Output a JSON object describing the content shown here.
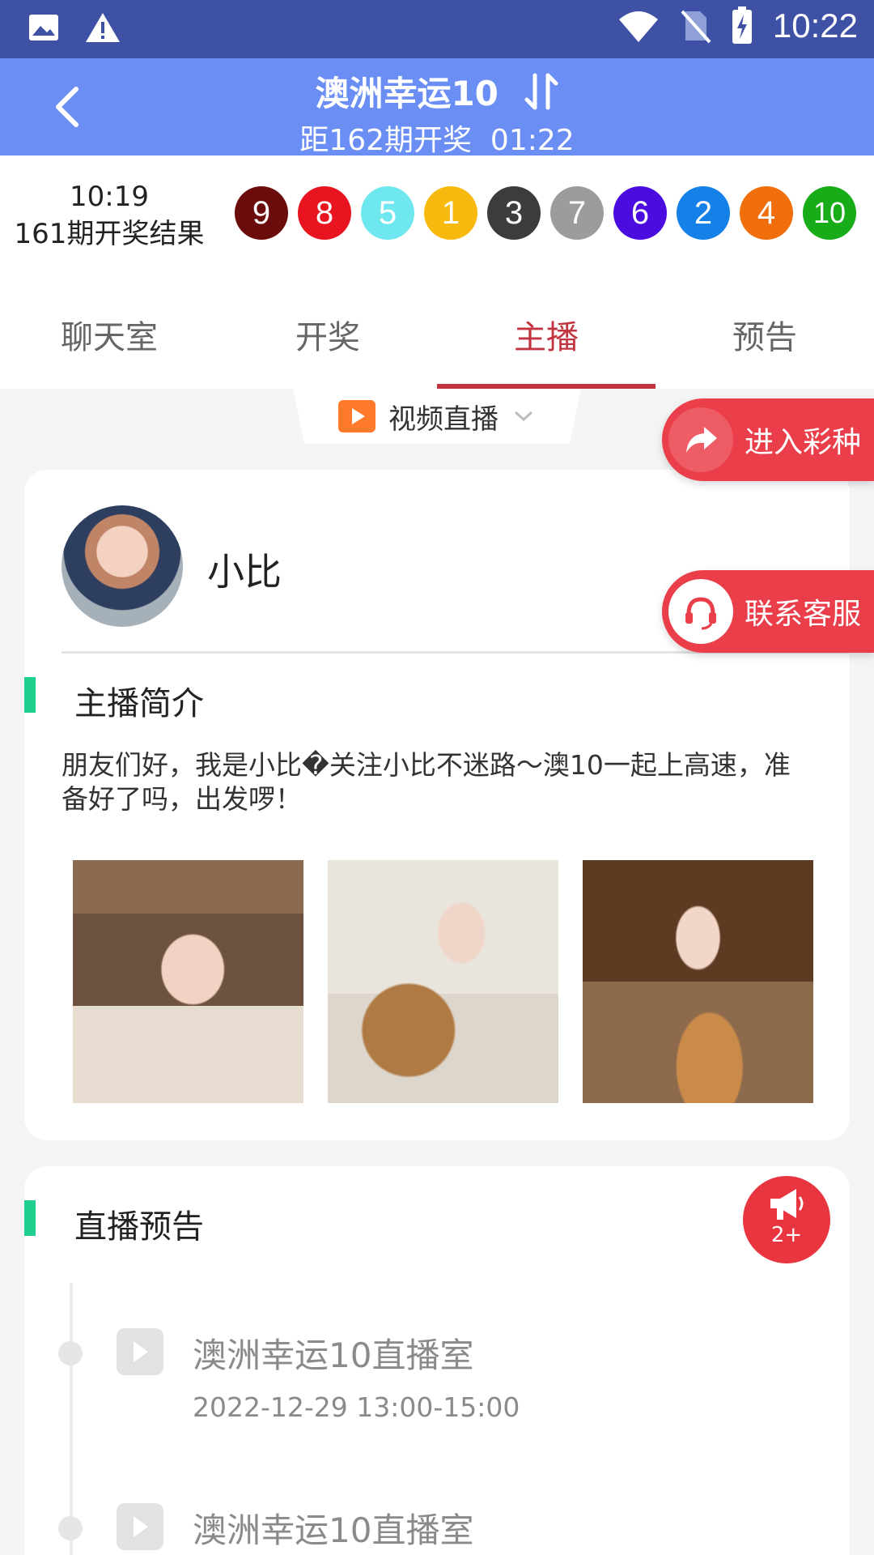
{
  "status_bar": {
    "time": "10:22",
    "icons": [
      "image-icon",
      "warning-icon",
      "wifi-icon",
      "no-sim-icon",
      "battery-charging-icon"
    ]
  },
  "header": {
    "title": "澳洲幸运10",
    "countdown_label": "距162期开奖",
    "countdown": "01:22"
  },
  "last_result": {
    "time": "10:19",
    "label": "161期开奖结果",
    "balls": [
      {
        "n": "9",
        "color": "#6b0c0c"
      },
      {
        "n": "8",
        "color": "#e8141f"
      },
      {
        "n": "5",
        "color": "#6ee8ee"
      },
      {
        "n": "1",
        "color": "#f7b90d"
      },
      {
        "n": "3",
        "color": "#3c3c3c"
      },
      {
        "n": "7",
        "color": "#9c9c9c"
      },
      {
        "n": "6",
        "color": "#4b0ce0"
      },
      {
        "n": "2",
        "color": "#1580e8"
      },
      {
        "n": "4",
        "color": "#f06f0c"
      },
      {
        "n": "10",
        "color": "#18ad18"
      }
    ]
  },
  "tabs": [
    "聊天室",
    "开奖",
    "主播",
    "预告"
  ],
  "active_tab": 2,
  "live_selector": {
    "label": "视频直播"
  },
  "float_buttons": {
    "enter": "进入彩种",
    "service": "联系客服"
  },
  "anchor": {
    "name": "小比",
    "intro_title": "主播简介",
    "intro": "朋友们好，我是小比�关注小比不迷路～澳10一起上高速，准备好了吗，出发啰！"
  },
  "schedule": {
    "title": "直播预告",
    "badge_count": "2+",
    "items": [
      {
        "name": "澳洲幸运10直播室",
        "time": "2022-12-29  13:00-15:00"
      },
      {
        "name": "澳洲幸运10直播室",
        "time": ""
      }
    ]
  },
  "colors": {
    "status_bar": "#3f51a5",
    "header": "#6b8ef5",
    "accent": "#c2343f",
    "float_button": "#ea3f4a",
    "section_bar": "#1fcf8e"
  }
}
